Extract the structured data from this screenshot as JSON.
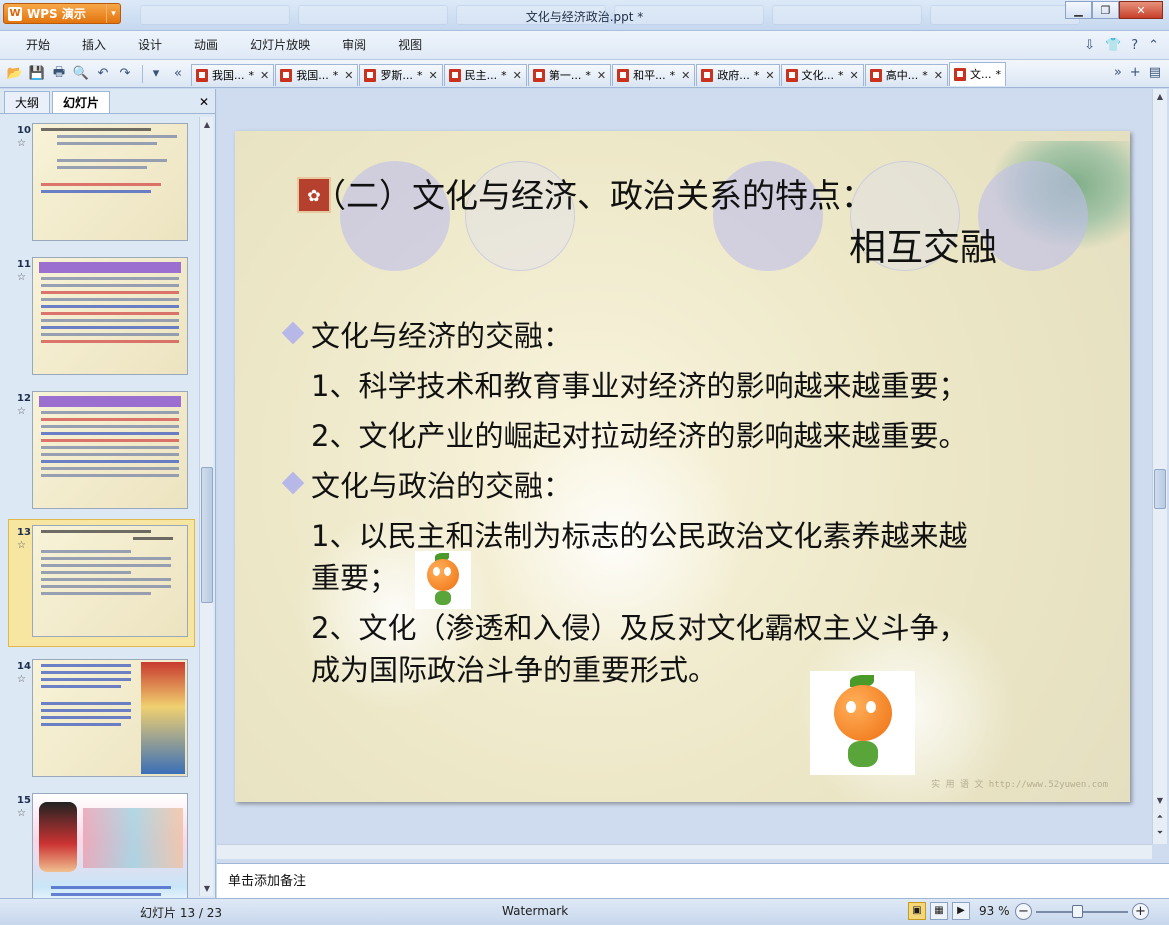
{
  "app": {
    "name": "WPS 演示",
    "window_title": "文化与经济政治.ppt *"
  },
  "menu": [
    "开始",
    "插入",
    "设计",
    "动画",
    "幻灯片放映",
    "审阅",
    "视图"
  ],
  "doc_tabs": [
    {
      "label": "我国...",
      "modified": "*"
    },
    {
      "label": "我国...",
      "modified": "*"
    },
    {
      "label": "罗斯...",
      "modified": "*"
    },
    {
      "label": "民主...",
      "modified": "*"
    },
    {
      "label": "第一...",
      "modified": "*"
    },
    {
      "label": "和平...",
      "modified": "*"
    },
    {
      "label": "政府...",
      "modified": "*"
    },
    {
      "label": "文化...",
      "modified": "*"
    },
    {
      "label": "高中...",
      "modified": "*"
    },
    {
      "label": "文...",
      "modified": "*"
    }
  ],
  "panel": {
    "tabs": [
      "大纲",
      "幻灯片"
    ],
    "active_tab": "幻灯片",
    "slides": [
      {
        "num": "10",
        "thumb_title": "(一) 文化与经济、政治的关系：相互影响"
      },
      {
        "num": "11",
        "thumb_title": "先进、健康的文化会促进社会的发展"
      },
      {
        "num": "12",
        "thumb_title": "落后、腐朽的文化会阻碍社会的发展"
      },
      {
        "num": "13",
        "thumb_title": "(二) 文化与经济、政治关系的特点：相互交融",
        "selected": true
      },
      {
        "num": "14",
        "thumb_title": "思考：文化在被美国利用吗"
      },
      {
        "num": "15",
        "thumb_title": "美国迪斯尼公司制作的动画片《花木兰》"
      }
    ]
  },
  "slide": {
    "title": "（二）文化与经济、政治关系的特点：",
    "subtitle": "相互交融",
    "lines": [
      {
        "text": "文化与经济的交融：",
        "bullet": true
      },
      {
        "text": "1、科学技术和教育事业对经济的影响越来越重要；",
        "bullet": false
      },
      {
        "text": "2、文化产业的崛起对拉动经济的影响越来越重要。",
        "bullet": false
      },
      {
        "text": "文化与政治的交融：",
        "bullet": true
      },
      {
        "text": "1、以民主和法制为标志的公民政治文化素养越来越",
        "bullet": false
      },
      {
        "text": "重要；",
        "bullet": false
      },
      {
        "text": "2、文化（渗透和入侵）及反对文化霸权主义斗争，",
        "bullet": false
      },
      {
        "text": "成为国际政治斗争的重要形式。",
        "bullet": false
      }
    ],
    "watermark": "实 用 语 文   http://www.52yuwen.com"
  },
  "notes": {
    "placeholder": "单击添加备注"
  },
  "status": {
    "slide_indicator": "幻灯片 13 / 23",
    "theme": "Watermark",
    "zoom": "93 %"
  },
  "colors": {
    "accent_orange": "#e2740e",
    "selected_thumb": "#f0c34c",
    "bullet_diamond": "#b8b8e8"
  }
}
